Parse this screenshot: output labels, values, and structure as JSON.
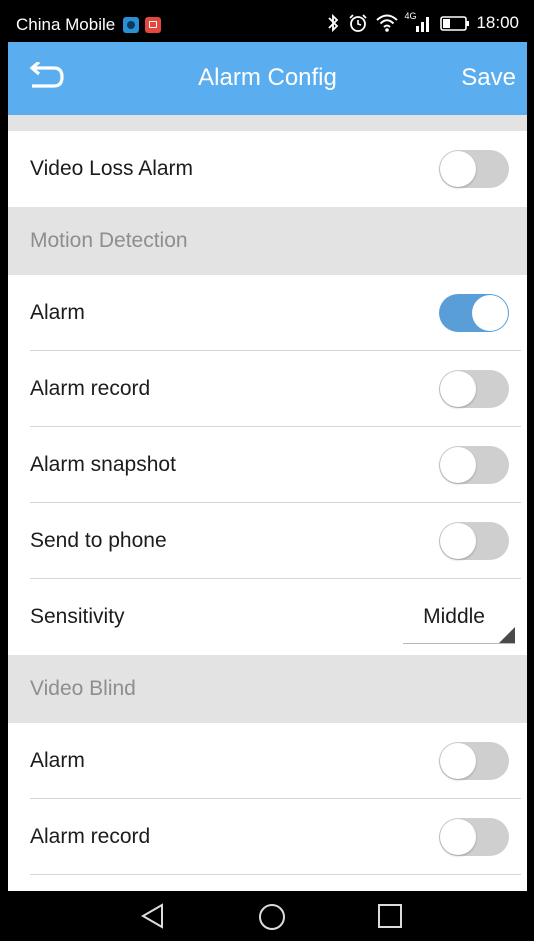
{
  "status_bar": {
    "carrier": "China Mobile",
    "time": "18:00",
    "network": "4G",
    "icons": [
      "app-blue-icon",
      "app-red-icon",
      "bluetooth-icon",
      "alarm-clock-icon",
      "wifi-icon",
      "signal-icon",
      "battery-icon"
    ]
  },
  "header": {
    "title": "Alarm Config",
    "save_label": "Save",
    "back_icon": "back-arrow-icon",
    "background": "#5aaeef"
  },
  "settings": {
    "video_loss": {
      "label": "Video Loss Alarm",
      "enabled": false
    },
    "motion_detection": {
      "title": "Motion Detection",
      "alarm": {
        "label": "Alarm",
        "enabled": true
      },
      "alarm_record": {
        "label": "Alarm record",
        "enabled": false
      },
      "alarm_snapshot": {
        "label": "Alarm snapshot",
        "enabled": false
      },
      "send_to_phone": {
        "label": "Send to phone",
        "enabled": false
      },
      "sensitivity": {
        "label": "Sensitivity",
        "value": "Middle"
      }
    },
    "video_blind": {
      "title": "Video Blind",
      "alarm": {
        "label": "Alarm",
        "enabled": false
      },
      "alarm_record": {
        "label": "Alarm record",
        "enabled": false
      }
    }
  },
  "colors": {
    "toggle_on": "#5a9ed8",
    "toggle_off": "#cfcfcf",
    "section_bg": "#e3e3e3"
  },
  "nav_bar": {
    "icons": [
      "back-triangle-icon",
      "home-circle-icon",
      "recents-square-icon"
    ]
  }
}
